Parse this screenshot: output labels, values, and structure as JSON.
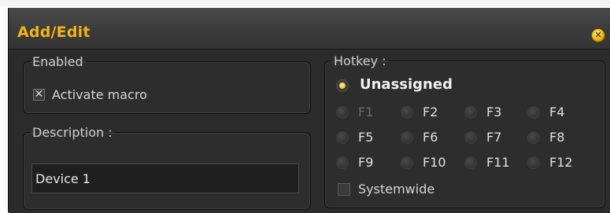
{
  "window": {
    "title": "Add/Edit",
    "close_icon": "close-icon"
  },
  "enabled_group": {
    "legend": "Enabled",
    "checkbox_label": "Activate macro",
    "checked": true
  },
  "description_group": {
    "legend": "Description :",
    "value": "Device 1"
  },
  "hotkey_group": {
    "legend": "Hotkey :",
    "selected_label": "Unassigned",
    "keys": [
      "F1",
      "F2",
      "F3",
      "F4",
      "F5",
      "F6",
      "F7",
      "F8",
      "F9",
      "F10",
      "F11",
      "F12"
    ],
    "disabled_keys": [
      "F1"
    ],
    "systemwide_label": "Systemwide",
    "systemwide_checked": false
  },
  "colors": {
    "accent": "#f2b21a",
    "panel": "#2b2b2b"
  }
}
